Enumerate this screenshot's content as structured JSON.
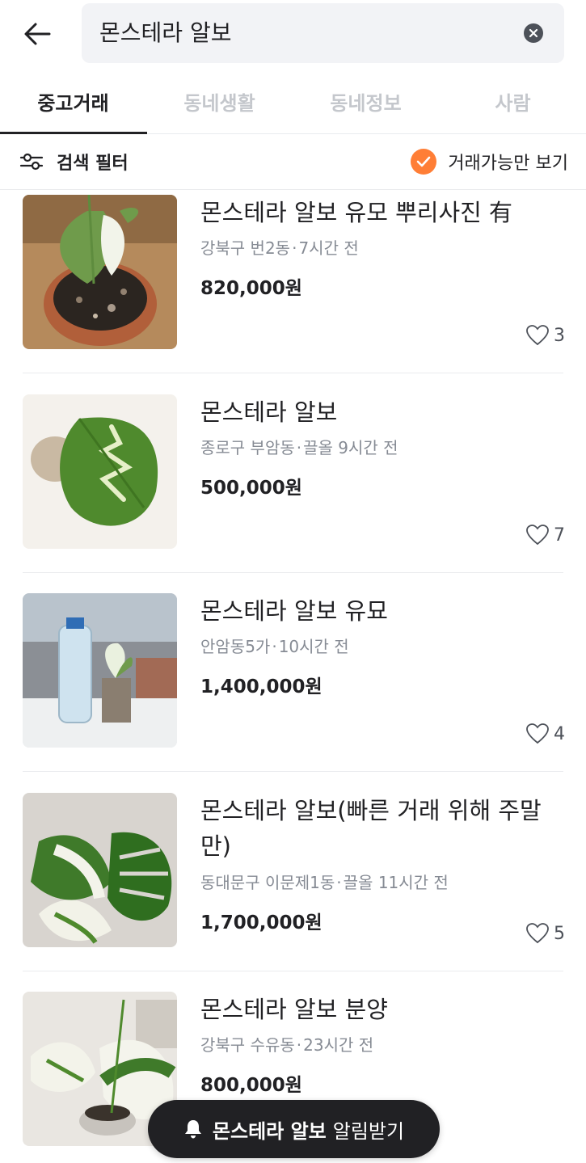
{
  "search": {
    "query": "몬스테라 알보"
  },
  "tabs": [
    {
      "label": "중고거래",
      "active": true
    },
    {
      "label": "동네생활",
      "active": false
    },
    {
      "label": "동네정보",
      "active": false
    },
    {
      "label": "사람",
      "active": false
    }
  ],
  "filter": {
    "label": "검색 필터",
    "available_only_label": "거래가능만 보기",
    "available_only_checked": true
  },
  "colors": {
    "accent": "#ff7e36",
    "text": "#212124",
    "muted": "#868b94",
    "pill": "#212124"
  },
  "items": [
    {
      "title": "몬스테라 알보 유모 뿌리사진 有",
      "location": "강북구 번2동",
      "time": "7시간 전",
      "price": "820,000원",
      "likes": "3"
    },
    {
      "title": "몬스테라 알보",
      "location": "종로구 부암동",
      "time": "끌올 9시간 전",
      "price": "500,000원",
      "likes": "7"
    },
    {
      "title": "몬스테라 알보 유묘",
      "location": "안암동5가",
      "time": "10시간 전",
      "price": "1,400,000원",
      "likes": "4"
    },
    {
      "title": "몬스테라 알보(빠른 거래 위해 주말만)",
      "location": "동대문구 이문제1동",
      "time": "끌올 11시간 전",
      "price": "1,700,000원",
      "likes": "5"
    },
    {
      "title": "몬스테라 알보 분양",
      "location": "강북구 수유동",
      "time": "23시간 전",
      "price": "800,000원",
      "likes": ""
    }
  ],
  "alert": {
    "keyword": "몬스테라 알보",
    "suffix": "알림받기",
    "icon": "bell-icon"
  }
}
